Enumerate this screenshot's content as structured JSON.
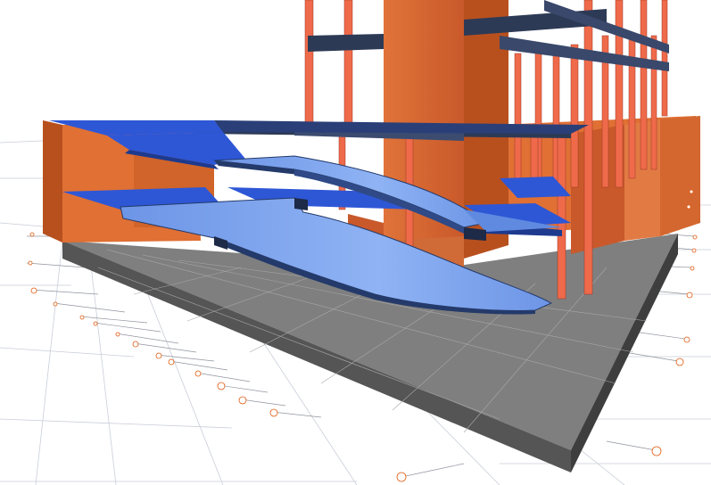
{
  "viewport": {
    "view_type": "3d-extruded-model",
    "projection": "perspective",
    "grid_visible": true
  },
  "model": {
    "elements": [
      "foundation-slab",
      "basement-walls",
      "core-shaft",
      "columns",
      "beams",
      "floor-slabs",
      "curved-ramps",
      "grid-bubbles"
    ]
  },
  "colors": {
    "background": "#ffffff",
    "grid_line": "#c9ced8",
    "grid_line_dark": "#8f949c",
    "foundation_top": "#7a7a7a",
    "foundation_side": "#4a4a4a",
    "wall": "#e07034",
    "wall_dark": "#b8501e",
    "column": "#ef6a4a",
    "column_dark": "#c24a32",
    "beam": "#2d3a56",
    "slab_blue": "#2e57d6",
    "ramp_light": "#7ea6f0",
    "ramp_edge": "#243a6a",
    "grid_bubble": "#e05a10"
  }
}
